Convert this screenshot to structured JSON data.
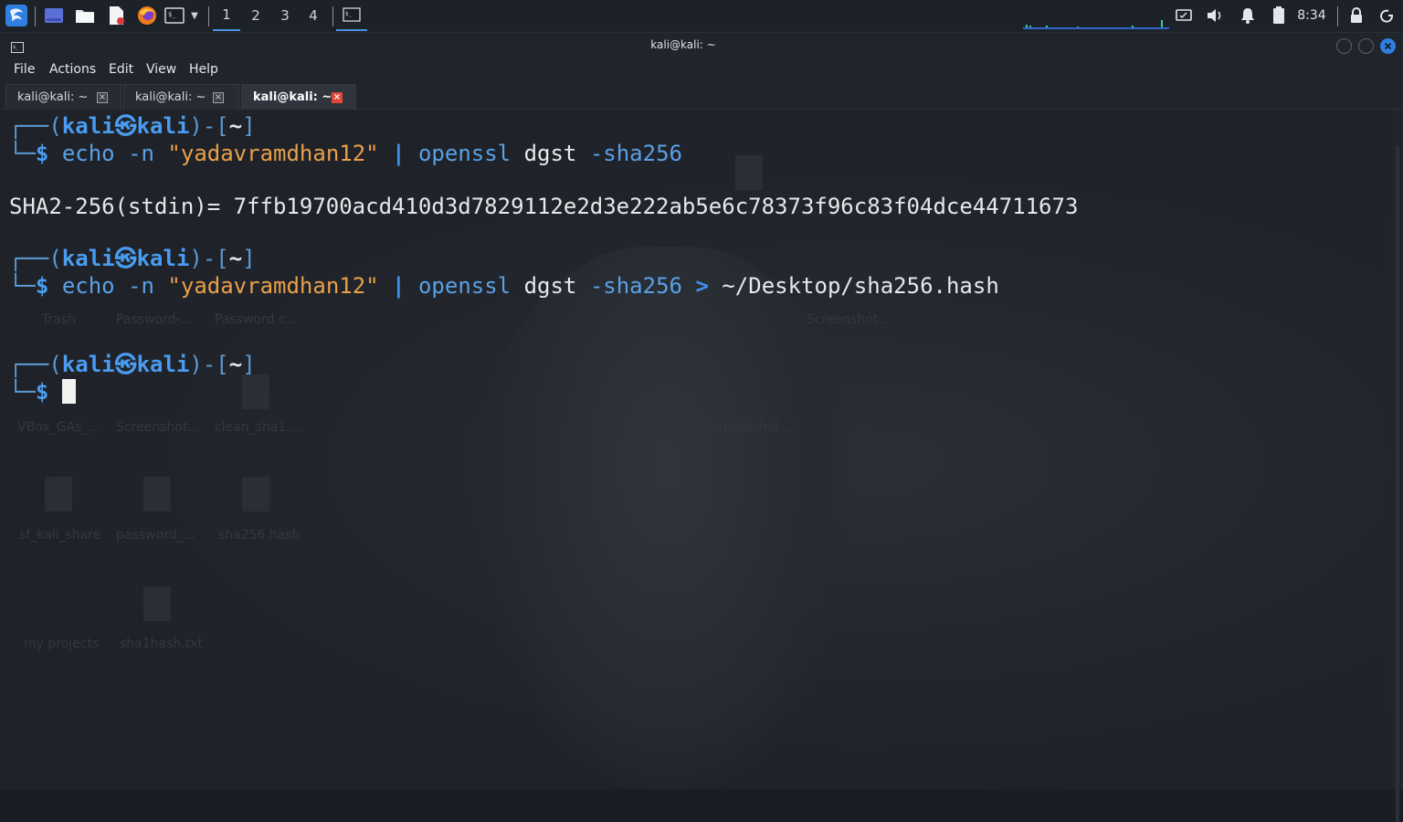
{
  "panel": {
    "workspaces": [
      "1",
      "2",
      "3",
      "4"
    ],
    "active_workspace": "1",
    "clock": "8:34"
  },
  "window": {
    "title": "kali@kali: ~",
    "menu": [
      "File",
      "Actions",
      "Edit",
      "View",
      "Help"
    ],
    "tabs": [
      {
        "label": "kali@kali: ~",
        "active": false
      },
      {
        "label": "kali@kali: ~",
        "active": false
      },
      {
        "label": "kali@kali: ~",
        "active": true
      }
    ]
  },
  "terminal": {
    "prompt": {
      "open": "┌──(",
      "user": "kali",
      "skull": "㉿",
      "host": "kali",
      "mid": ")-[",
      "dir": "~",
      "close": "]",
      "corner": "└─",
      "dollar": "$"
    },
    "commands": [
      {
        "cmd": "echo",
        "flag": "-n",
        "string": "\"yadavramdhan12\"",
        "pipe": "|",
        "prog": "openssl",
        "sub": "dgst",
        "opt": "-sha256"
      },
      {
        "cmd": "echo",
        "flag": "-n",
        "string": "\"yadavramdhan12\"",
        "pipe": "|",
        "prog": "openssl",
        "sub": "dgst",
        "opt": "-sha256",
        "redir": ">",
        "target": "~/Desktop/sha256.hash"
      }
    ],
    "output": "SHA2-256(stdin)= 7ffb19700acd410d3d7829112e2d3e222ab5e6c78373f96c83f04dce44711673"
  },
  "desktop_ghosts": [
    "Trash",
    "Password-...",
    "Password c...",
    "Screenshot...",
    "VBox_GAs_...",
    "Screenshot...",
    "clean_sha1....",
    "Screenshot...",
    "sf_kali_share",
    "password_...",
    "sha256.hash",
    "my projects",
    "sha1hash.txt"
  ],
  "colors": {
    "accent": "#4a8fe3",
    "string": "#e9a04a",
    "close_active": "#e2463a"
  }
}
